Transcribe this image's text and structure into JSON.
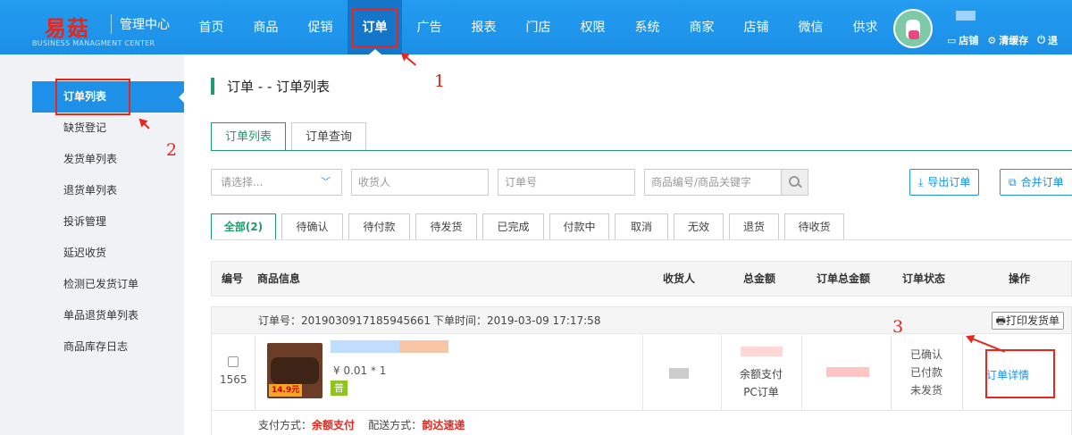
{
  "header": {
    "logo_text": "易菇",
    "title": "管理中心",
    "subtitle": "BUSINESS MANAGMENT CENTER",
    "nav": [
      "首页",
      "商品",
      "促销",
      "订单",
      "广告",
      "报表",
      "门店",
      "权限",
      "系统",
      "商家",
      "店铺",
      "微信",
      "供求"
    ],
    "active_nav": "订单",
    "actions": [
      {
        "icon": "store-icon",
        "label": "店铺"
      },
      {
        "icon": "gear-icon",
        "label": "清缓存"
      },
      {
        "icon": "power-icon",
        "label": "退"
      }
    ]
  },
  "sidebar": {
    "items": [
      "订单列表",
      "缺货登记",
      "发货单列表",
      "退货单列表",
      "投诉管理",
      "延迟收货",
      "检测已发货订单",
      "单品退货单列表",
      "商品库存日志"
    ],
    "active": "订单列表"
  },
  "main": {
    "page_title": "订单 - - 订单列表",
    "tabs": [
      "订单列表",
      "订单查询"
    ],
    "filters": {
      "select_placeholder": "请选择...",
      "receiver_placeholder": "收货人",
      "order_no_placeholder": "订单号",
      "keyword_placeholder": "商品编号/商品关键字",
      "export_label": "导出订单",
      "merge_label": "合并订单"
    },
    "status_tabs": [
      "全部(2)",
      "待确认",
      "待付款",
      "待发货",
      "已完成",
      "付款中",
      "取消",
      "无效",
      "退货",
      "待收货"
    ],
    "columns": [
      "编号",
      "商品信息",
      "收货人",
      "总金额",
      "订单总金额",
      "订单状态",
      "操作"
    ],
    "order": {
      "order_no_text": "订单号：2019030917185945661",
      "time_text": "下单时间：2019-03-09 17:17:58",
      "print_label": "打印发货单",
      "id": "1565",
      "price_text": "¥ 0.01 * 1",
      "badge": "普",
      "image_tag": "14.9元",
      "pay_lines": [
        "余额支付",
        "PC订单"
      ],
      "status_lines": [
        "已确认",
        "已付款",
        "未发货"
      ],
      "detail_label": "订单详情",
      "pay_method_label": "支付方式：",
      "pay_method": "余额支付",
      "delivery_label": "配送方式：",
      "delivery": "韵达速递"
    }
  },
  "annotations": [
    "1",
    "2",
    "3"
  ],
  "colors": {
    "topbar": "#1b8fe6",
    "accent_green": "#1a9e6b",
    "accent_blue": "#1e90e8",
    "annotation_red": "#e8261c"
  }
}
